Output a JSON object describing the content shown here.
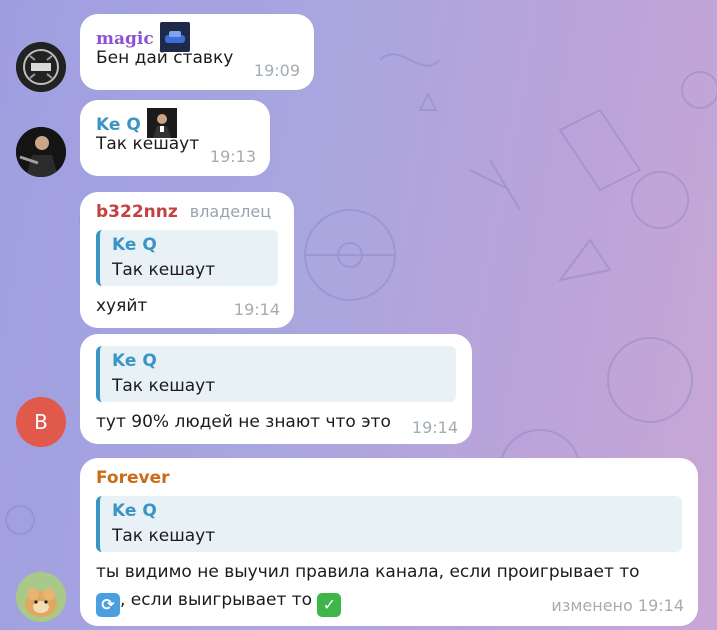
{
  "colors": {
    "magic": "#8a52d0",
    "keq": "#3a95c4",
    "b322nnz": "#c24141",
    "forever": "#cc6b16",
    "avatar_b": "#e0594b"
  },
  "messages": [
    {
      "sender": "magic",
      "text": "Бен дай ставку",
      "time": "19:09",
      "avatar_icon": "dark-logo-avatar"
    },
    {
      "sender": "Ke Q",
      "text": "Так кешаут",
      "time": "19:13",
      "avatar_icon": "person-avatar"
    },
    {
      "sender": "b322nnz",
      "role": "владелец",
      "reply": {
        "name": "Ke Q",
        "text": "Так кешаут"
      },
      "text": "хуяйт",
      "time": "19:14"
    },
    {
      "reply": {
        "name": "Ke Q",
        "text": "Так кешаут"
      },
      "text": "тут 90% людей не знают что это",
      "time": "19:14",
      "avatar_letter": "B"
    },
    {
      "sender": "Forever",
      "reply": {
        "name": "Ke Q",
        "text": "Так кешаут"
      },
      "text_line1": "ты видимо не выучил правила канала, если проигрывает то",
      "text_line2": ", если выигрывает то",
      "time": "изменено 19:14",
      "avatar_icon": "hamster-avatar"
    }
  ]
}
